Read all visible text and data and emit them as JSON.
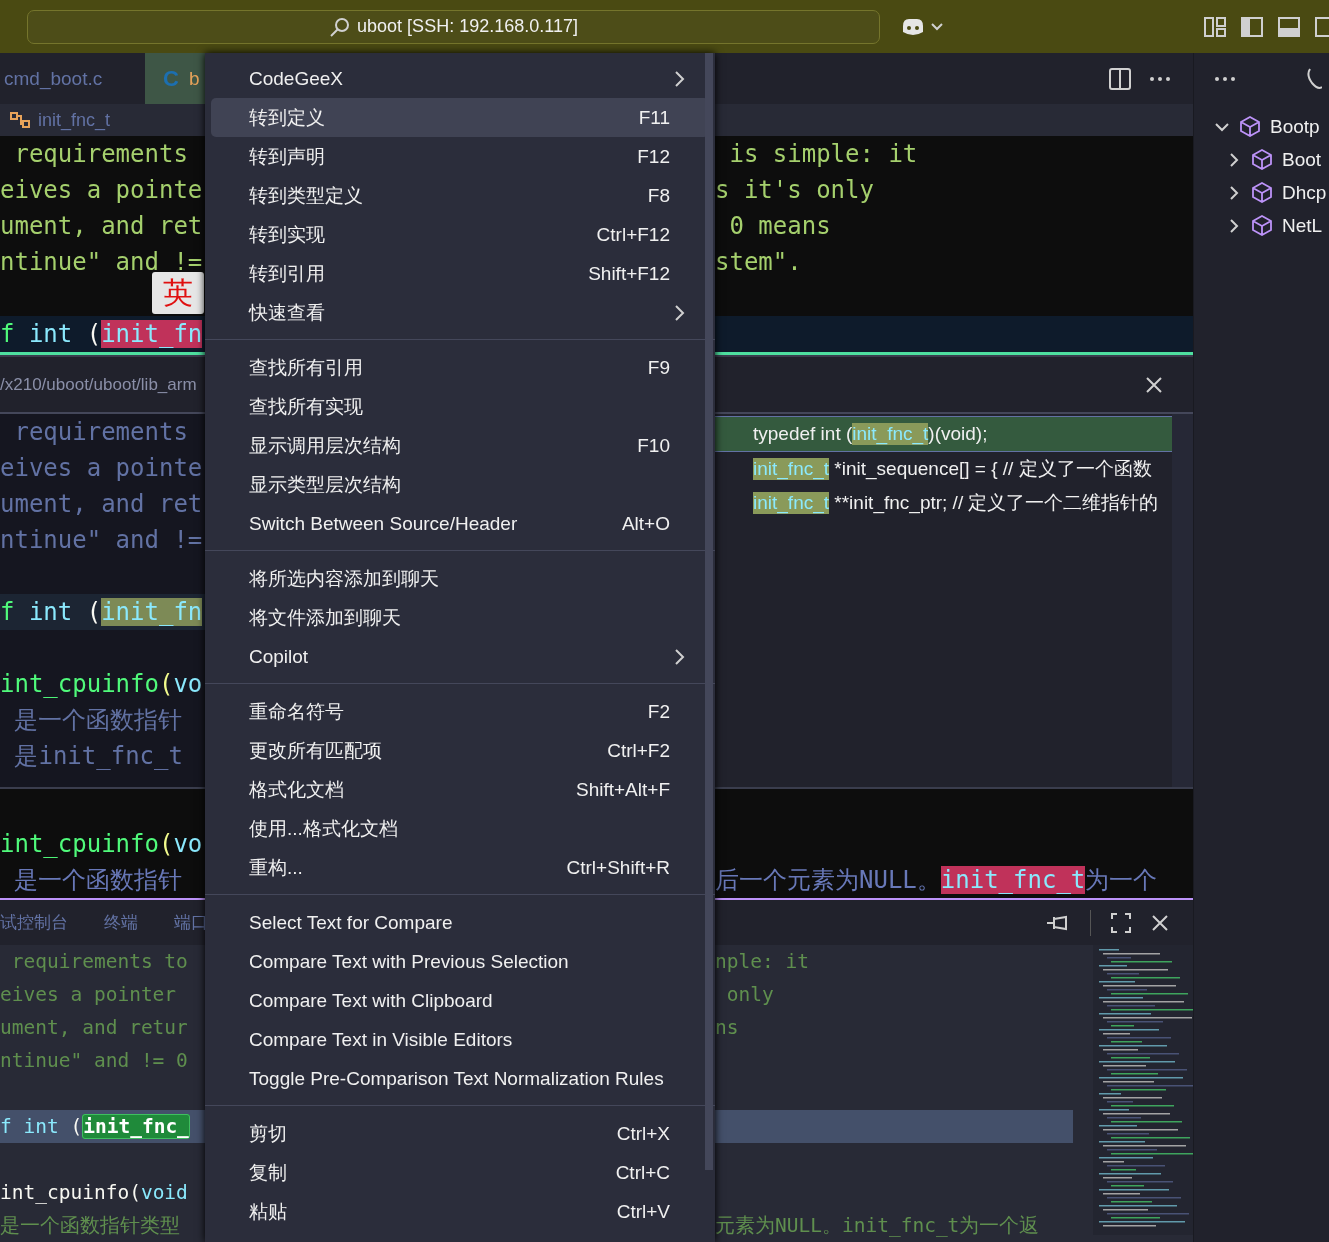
{
  "title_bar": {
    "search": "uboot [SSH: 192.168.0.117]"
  },
  "editor_tabs": [
    {
      "label": "cmd_boot.c",
      "selected": false
    },
    {
      "icon": "C",
      "label": "b",
      "selected": true
    }
  ],
  "breadcrumb": "init_fnc_t",
  "ime_indicator": "英",
  "editor": {
    "left": [
      {
        "kind": "code",
        "current": false,
        "segments": [
          {
            "text": " requirements",
            "kind": "comment"
          }
        ]
      },
      {
        "kind": "code",
        "current": false,
        "segments": [
          {
            "text": "eives a pointe",
            "kind": "comment"
          }
        ]
      },
      {
        "kind": "code",
        "current": false,
        "segments": [
          {
            "text": "ument, and ret",
            "kind": "comment"
          }
        ]
      },
      {
        "kind": "code",
        "current": false,
        "segments": [
          {
            "text": "ntinue\" and !=",
            "kind": "comment"
          }
        ]
      },
      {
        "kind": "blank",
        "current": false
      },
      {
        "kind": "code",
        "current": true,
        "segments": [
          {
            "text": "f",
            "kind": "keyword"
          },
          {
            "text": " int ",
            "kind": "type"
          },
          {
            "text": "(",
            "kind": "punct"
          },
          {
            "text": "init_fn",
            "kind": "match-red"
          }
        ]
      }
    ],
    "right": [
      {
        "kind": "code",
        "current": false,
        "segments": [
          {
            "text": " is simple: it",
            "kind": "comment"
          }
        ]
      },
      {
        "kind": "code",
        "current": false,
        "segments": [
          {
            "text": "s it's only",
            "kind": "comment"
          }
        ]
      },
      {
        "kind": "code",
        "current": false,
        "segments": [
          {
            "text": " 0 means",
            "kind": "comment"
          }
        ]
      },
      {
        "kind": "code",
        "current": false,
        "segments": [
          {
            "text": "stem\".",
            "kind": "comment"
          }
        ]
      },
      {
        "kind": "blank",
        "current": false
      },
      {
        "kind": "blank",
        "current": true
      }
    ]
  },
  "peek": {
    "path": "/x210/uboot/uboot/lib_arm",
    "left": [
      {
        "kind": "code",
        "current": false,
        "segments": [
          {
            "text": " requirements",
            "kind": "comment"
          }
        ]
      },
      {
        "kind": "code",
        "current": false,
        "segments": [
          {
            "text": "eives a pointe",
            "kind": "comment"
          }
        ]
      },
      {
        "kind": "code",
        "current": false,
        "segments": [
          {
            "text": "ument, and ret",
            "kind": "comment"
          }
        ]
      },
      {
        "kind": "code",
        "current": false,
        "segments": [
          {
            "text": "ntinue\" and !=",
            "kind": "comment"
          }
        ]
      },
      {
        "kind": "blank",
        "current": false
      },
      {
        "kind": "code",
        "current": true,
        "segments": [
          {
            "text": "f",
            "kind": "keyword"
          },
          {
            "text": " int ",
            "kind": "type"
          },
          {
            "text": "(",
            "kind": "punct"
          },
          {
            "text": "init_fn",
            "kind": "match-olive"
          }
        ]
      },
      {
        "kind": "blank",
        "current": false
      },
      {
        "kind": "code",
        "current": false,
        "segments": [
          {
            "text": "int_cpuinfo",
            "kind": "func"
          },
          {
            "text": "(",
            "kind": "paren"
          },
          {
            "text": "vo",
            "kind": "type"
          }
        ]
      },
      {
        "kind": "code",
        "current": false,
        "segments": [
          {
            "text": " 是一个函数指针",
            "kind": "comment"
          }
        ]
      },
      {
        "kind": "code",
        "current": false,
        "segments": [
          {
            "text": " 是init_fnc_t",
            "kind": "comment"
          }
        ]
      }
    ],
    "references": [
      {
        "selected": true,
        "segments": [
          {
            "text": "typedef int (",
            "kind": "plain"
          },
          {
            "text": "init_fnc_t",
            "kind": "match"
          },
          {
            "text": ")(void);",
            "kind": "plain"
          }
        ]
      },
      {
        "selected": false,
        "segments": [
          {
            "text": "init_fnc_t",
            "kind": "match"
          },
          {
            "text": " *init_sequence[] = { // 定义了一个函数",
            "kind": "plain"
          }
        ]
      },
      {
        "selected": false,
        "segments": [
          {
            "text": "init_fnc_t",
            "kind": "match"
          },
          {
            "text": " **init_fnc_ptr; // 定义了一个二维指针的",
            "kind": "plain"
          }
        ]
      }
    ]
  },
  "editor_lower": {
    "left": [
      {
        "kind": "code",
        "current": false,
        "segments": [
          {
            "text": "int_cpuinfo",
            "kind": "func"
          },
          {
            "text": "(",
            "kind": "paren"
          },
          {
            "text": "vo",
            "kind": "type"
          }
        ]
      },
      {
        "kind": "code",
        "current": false,
        "segments": [
          {
            "text": " 是一个函数指针",
            "kind": "comment"
          }
        ]
      }
    ],
    "right": [
      {
        "kind": "blank",
        "current": false
      },
      {
        "kind": "code",
        "current": false,
        "segments": [
          {
            "text": "后一个元素为NULL。",
            "kind": "comment"
          },
          {
            "text": "init_fnc_t",
            "kind": "match-red"
          },
          {
            "text": "为一个",
            "kind": "comment"
          }
        ]
      }
    ]
  },
  "panel": {
    "tabs": [
      {
        "label": "试控制台"
      },
      {
        "label": "终端"
      },
      {
        "label": "端口"
      }
    ],
    "left": [
      {
        "kind": "code",
        "current": false,
        "segments": [
          {
            "text": " requirements to",
            "kind": "comment"
          }
        ]
      },
      {
        "kind": "code",
        "current": false,
        "segments": [
          {
            "text": "eives a pointer",
            "kind": "comment"
          }
        ]
      },
      {
        "kind": "code",
        "current": false,
        "segments": [
          {
            "text": "ument, and retur",
            "kind": "comment"
          }
        ]
      },
      {
        "kind": "code",
        "current": false,
        "segments": [
          {
            "text": "ntinue\" and != 0",
            "kind": "comment"
          }
        ]
      },
      {
        "kind": "blank",
        "current": false
      },
      {
        "kind": "code",
        "current": true,
        "segments": [
          {
            "text": "f",
            "kind": "type"
          },
          {
            "text": " int ",
            "kind": "type"
          },
          {
            "text": "(",
            "kind": "punct"
          },
          {
            "text": "init_fnc_",
            "kind": "match-green"
          }
        ]
      },
      {
        "kind": "blank",
        "current": false
      },
      {
        "kind": "code",
        "current": false,
        "segments": [
          {
            "text": "int_cpuinfo",
            "kind": "plain"
          },
          {
            "text": "(",
            "kind": "punct"
          },
          {
            "text": "void",
            "kind": "type"
          }
        ]
      },
      {
        "kind": "code",
        "current": false,
        "segments": [
          {
            "text": "是一个函数指针类型",
            "kind": "comment"
          }
        ]
      }
    ],
    "right": [
      {
        "kind": "code",
        "current": false,
        "segments": [
          {
            "text": "nple: it",
            "kind": "comment"
          }
        ]
      },
      {
        "kind": "code",
        "current": false,
        "segments": [
          {
            "text": " only",
            "kind": "comment"
          }
        ]
      },
      {
        "kind": "code",
        "current": false,
        "segments": [
          {
            "text": "ns",
            "kind": "comment"
          }
        ]
      },
      {
        "kind": "blank",
        "current": false
      },
      {
        "kind": "blank",
        "current": false
      },
      {
        "kind": "blank",
        "current": true
      },
      {
        "kind": "blank",
        "current": false
      },
      {
        "kind": "blank",
        "current": false
      },
      {
        "kind": "code",
        "current": false,
        "segments": [
          {
            "text": "元素为NULL。init_fnc_t为一个返",
            "kind": "comment"
          }
        ]
      }
    ]
  },
  "outline": [
    {
      "label": "Bootp",
      "expanded": true,
      "children": [
        {
          "label": "Boot",
          "expanded": false
        },
        {
          "label": "Dhcp",
          "expanded": false
        },
        {
          "label": "NetL",
          "expanded": false
        }
      ]
    }
  ],
  "context_menu": [
    [
      {
        "label": "CodeGeeX",
        "submenu": true,
        "selected": false
      },
      {
        "label": "转到定义",
        "shortcut": "F11",
        "submenu": false,
        "selected": true
      },
      {
        "label": "转到声明",
        "shortcut": "F12",
        "submenu": false,
        "selected": false
      },
      {
        "label": "转到类型定义",
        "shortcut": "F8",
        "submenu": false,
        "selected": false
      },
      {
        "label": "转到实现",
        "shortcut": "Ctrl+F12",
        "submenu": false,
        "selected": false
      },
      {
        "label": "转到引用",
        "shortcut": "Shift+F12",
        "submenu": false,
        "selected": false
      },
      {
        "label": "快速查看",
        "submenu": true,
        "selected": false
      }
    ],
    [
      {
        "label": "查找所有引用",
        "shortcut": "F9",
        "submenu": false,
        "selected": false
      },
      {
        "label": "查找所有实现",
        "submenu": false,
        "selected": false
      },
      {
        "label": "显示调用层次结构",
        "shortcut": "F10",
        "submenu": false,
        "selected": false
      },
      {
        "label": "显示类型层次结构",
        "submenu": false,
        "selected": false
      },
      {
        "label": "Switch Between Source/Header",
        "shortcut": "Alt+O",
        "submenu": false,
        "selected": false
      }
    ],
    [
      {
        "label": "将所选内容添加到聊天",
        "submenu": false,
        "selected": false
      },
      {
        "label": "将文件添加到聊天",
        "submenu": false,
        "selected": false
      },
      {
        "label": "Copilot",
        "submenu": true,
        "selected": false
      }
    ],
    [
      {
        "label": "重命名符号",
        "shortcut": "F2",
        "submenu": false,
        "selected": false
      },
      {
        "label": "更改所有匹配项",
        "shortcut": "Ctrl+F2",
        "submenu": false,
        "selected": false
      },
      {
        "label": "格式化文档",
        "shortcut": "Shift+Alt+F",
        "submenu": false,
        "selected": false
      },
      {
        "label": "使用...格式化文档",
        "submenu": false,
        "selected": false
      },
      {
        "label": "重构...",
        "shortcut": "Ctrl+Shift+R",
        "submenu": false,
        "selected": false
      }
    ],
    [
      {
        "label": "Select Text for Compare",
        "submenu": false,
        "selected": false
      },
      {
        "label": "Compare Text with Previous Selection",
        "submenu": false,
        "selected": false
      },
      {
        "label": "Compare Text with Clipboard",
        "submenu": false,
        "selected": false
      },
      {
        "label": "Compare Text in Visible Editors",
        "submenu": false,
        "selected": false
      },
      {
        "label": "Toggle Pre-Comparison Text Normalization Rules",
        "submenu": false,
        "selected": false
      }
    ],
    [
      {
        "label": "剪切",
        "shortcut": "Ctrl+X",
        "submenu": false,
        "selected": false
      },
      {
        "label": "复制",
        "shortcut": "Ctrl+C",
        "submenu": false,
        "selected": false
      },
      {
        "label": "粘贴",
        "shortcut": "Ctrl+V",
        "submenu": false,
        "selected": false
      }
    ]
  ]
}
